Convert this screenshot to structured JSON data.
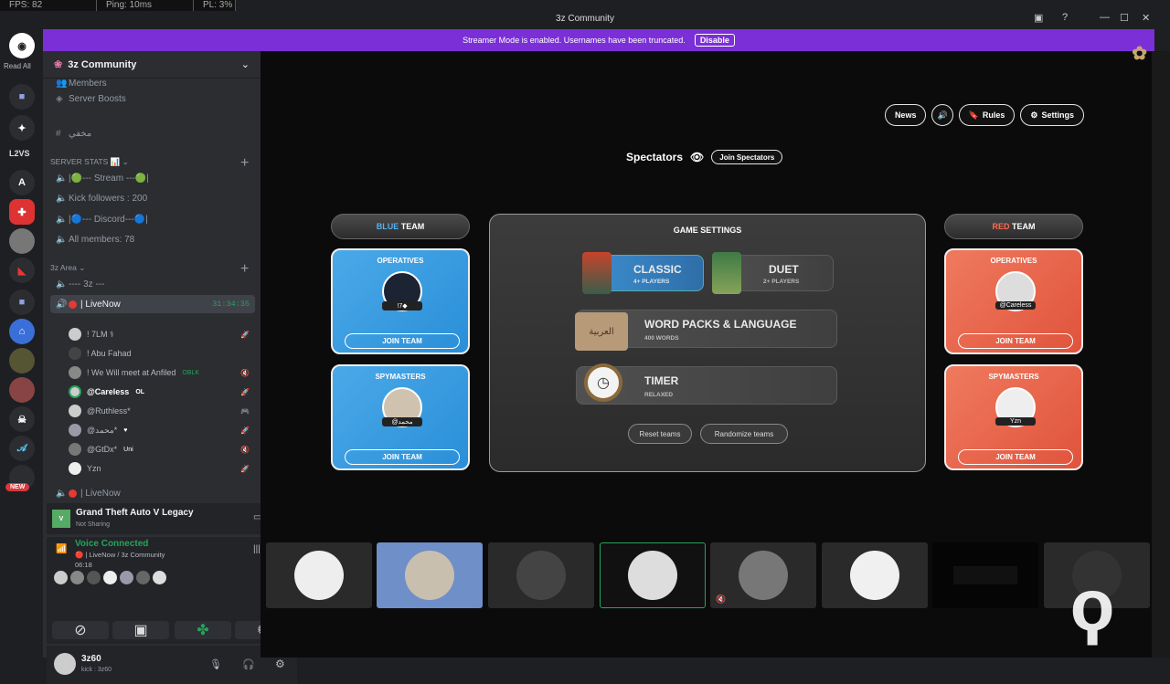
{
  "titlebar": {
    "fps": "FPS: 82",
    "ping": "Ping: 10ms",
    "pl": "PL: 3%",
    "title": "3z Community"
  },
  "banner": {
    "text": "Streamer Mode is enabled. Usernames have been truncated.",
    "button": "Disable"
  },
  "rail": {
    "read_all": "Read All",
    "l2vs": "L2VS",
    "a": "A",
    "new": "NEW"
  },
  "sidebar": {
    "server_name": "3z Community",
    "members": "Members",
    "server_boosts": "Server Boosts",
    "hidden_channel": "مخفي",
    "stats_category": "SERVER STATS 📊",
    "stream": "|🟢--- Stream ---🟢|",
    "kick_followers": "Kick followers : 200",
    "discord": "|🔵--- Discord---🔵|",
    "all_members": "All members: 78",
    "area_category": "3z Area",
    "three_z": "---- 3z ---",
    "livenow": "| LiveNow",
    "livenow_time": "31:34:35",
    "users": [
      {
        "name": "! 7LM ⚕",
        "badge": ""
      },
      {
        "name": "! Abu Fahad",
        "badge": ""
      },
      {
        "name": "! We Will meet at Anfiled",
        "badge": "OBLK"
      },
      {
        "name": "@Careless",
        "badge": "OL"
      },
      {
        "name": "@Ruthless*",
        "badge": ""
      },
      {
        "name": "@محمد*",
        "badge": "♥"
      },
      {
        "name": "@GtDx*",
        "badge": "Uni"
      },
      {
        "name": "Yzn",
        "badge": ""
      }
    ],
    "livenow2": "| LiveNow"
  },
  "activity": {
    "game": "Grand Theft Auto V Legacy",
    "status": "Not Sharing"
  },
  "voice": {
    "title": "Voice Connected",
    "channel": "| LiveNow / 3z Community",
    "time": "06:18"
  },
  "user": {
    "name": "3z60",
    "status": "kick : 3z60"
  },
  "game": {
    "buttons": [
      "News",
      "Rules",
      "Settings"
    ],
    "spectators": "Spectators",
    "join_spectators": "Join Spectators",
    "blue_team": {
      "word": "BLUE",
      "team": "TEAM"
    },
    "red_team": {
      "word": "RED",
      "team": "TEAM"
    },
    "operatives": "OPERATIVES",
    "spymasters": "SPYMASTERS",
    "join_team": "JOIN TEAM",
    "blue_operative": "!7◆",
    "blue_spymaster": "@محمد",
    "red_operative": "@Careless",
    "red_spymaster": "Yzn",
    "settings_title": "GAME SETTINGS",
    "classic": {
      "title": "CLASSIC",
      "sub": "4+ PLAYERS"
    },
    "duet": {
      "title": "DUET",
      "sub": "2+ PLAYERS"
    },
    "wordpacks": {
      "title": "WORD PACKS & LANGUAGE",
      "sub": "400 WORDS",
      "arabic": "العربية"
    },
    "timer": {
      "title": "TIMER",
      "sub": "RELAXED"
    },
    "reset": "Reset teams",
    "randomize": "Randomize teams"
  },
  "colors": {
    "blue": "#3b9ee0",
    "red": "#e9644a",
    "accent": "#7b2fd6",
    "green": "#23a55a"
  }
}
